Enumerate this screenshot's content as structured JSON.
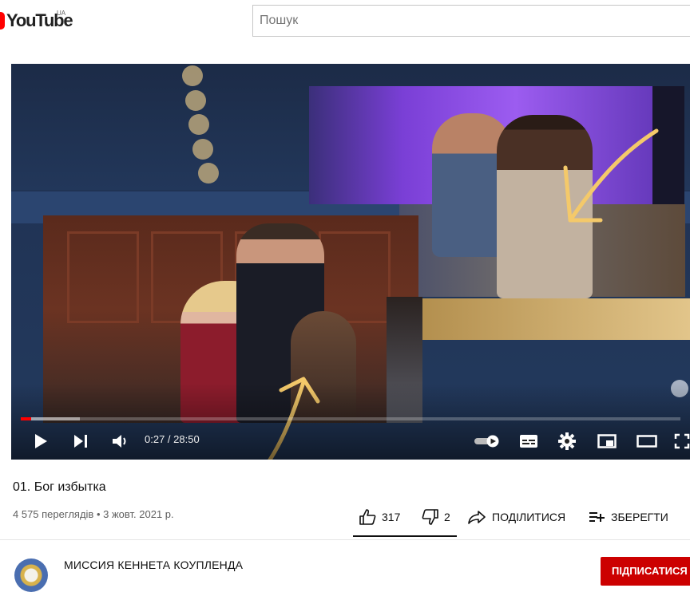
{
  "masthead": {
    "logo_text": "YouTube",
    "country_code": "UA",
    "search_placeholder": "Пошук"
  },
  "player": {
    "current_time": "0:27",
    "separator": " / ",
    "duration": "28:50",
    "played_fraction": 0.016,
    "buffered_fraction": 0.09
  },
  "video": {
    "title": "01. Бог избытка",
    "views": "4 575 переглядів",
    "dot": " • ",
    "date": "3 жовт. 2021 р.",
    "likes": "317",
    "dislikes": "2",
    "share_label": "ПОДІЛИТИСЯ",
    "save_label": "ЗБЕРЕГТИ"
  },
  "channel": {
    "name": "МИССИЯ КЕННЕТА КОУПЛЕНДА",
    "subscribe_label": "ПІДПИСАТИСЯ"
  },
  "colors": {
    "brand_red": "#ff0000",
    "annotation_yellow": "#f4c96a"
  },
  "icons": [
    "youtube-logo-icon",
    "play-icon",
    "next-icon",
    "volume-icon",
    "autoplay-toggle-icon",
    "subtitles-icon",
    "settings-gear-icon",
    "miniplayer-icon",
    "theater-mode-icon",
    "fullscreen-icon",
    "thumbs-up-icon",
    "thumbs-down-icon",
    "share-arrow-icon",
    "add-to-playlist-icon"
  ]
}
